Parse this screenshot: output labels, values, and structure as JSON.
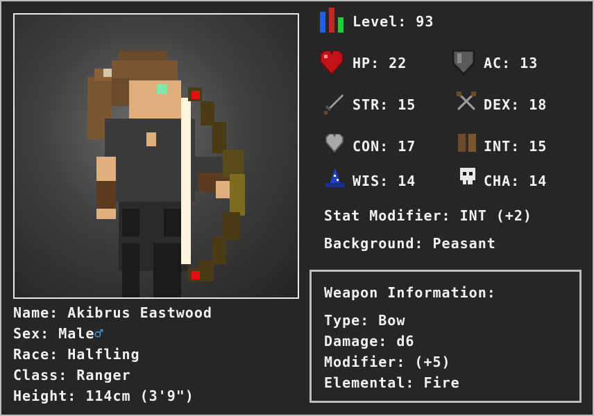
{
  "character": {
    "name_label": "Name:",
    "name": "Akibrus Eastwood",
    "sex_label": "Sex:",
    "sex": "Male",
    "sex_symbol": "♂",
    "race_label": "Race:",
    "race": "Halfling",
    "class_label": "Class:",
    "class": "Ranger",
    "height_label": "Height:",
    "height": "114cm (3'9\")"
  },
  "stats": {
    "level_label": "Level:",
    "level": "93",
    "hp_label": "HP:",
    "hp": "22",
    "ac_label": "AC:",
    "ac": "13",
    "str_label": "STR:",
    "str": "15",
    "dex_label": "DEX:",
    "dex": "18",
    "con_label": "CON:",
    "con": "17",
    "int_label": "INT:",
    "int": "15",
    "wis_label": "WIS:",
    "wis": "14",
    "cha_label": "CHA:",
    "cha": "14"
  },
  "extra": {
    "modifier_label": "Stat Modifier:",
    "modifier": "INT (+2)",
    "background_label": "Background:",
    "background": "Peasant"
  },
  "weapon": {
    "title": "Weapon Information:",
    "type_label": "Type:",
    "type": "Bow",
    "damage_label": "Damage:",
    "damage": "d6",
    "modifier_label": "Modifier:",
    "modifier": "(+5)",
    "elemental_label": "Elemental:",
    "elemental": "Fire"
  },
  "icons": {
    "level": "level-bars-icon",
    "hp": "heart-icon",
    "ac": "shield-icon",
    "str": "sword-icon",
    "dex": "crossed-daggers-icon",
    "con": "gray-heart-icon",
    "int": "book-icon",
    "wis": "wizard-hat-icon",
    "cha": "skull-icon"
  },
  "colors": {
    "sex_symbol": "#3ea0e6",
    "panel_bg": "#262626",
    "text": "#f2f2f2"
  }
}
